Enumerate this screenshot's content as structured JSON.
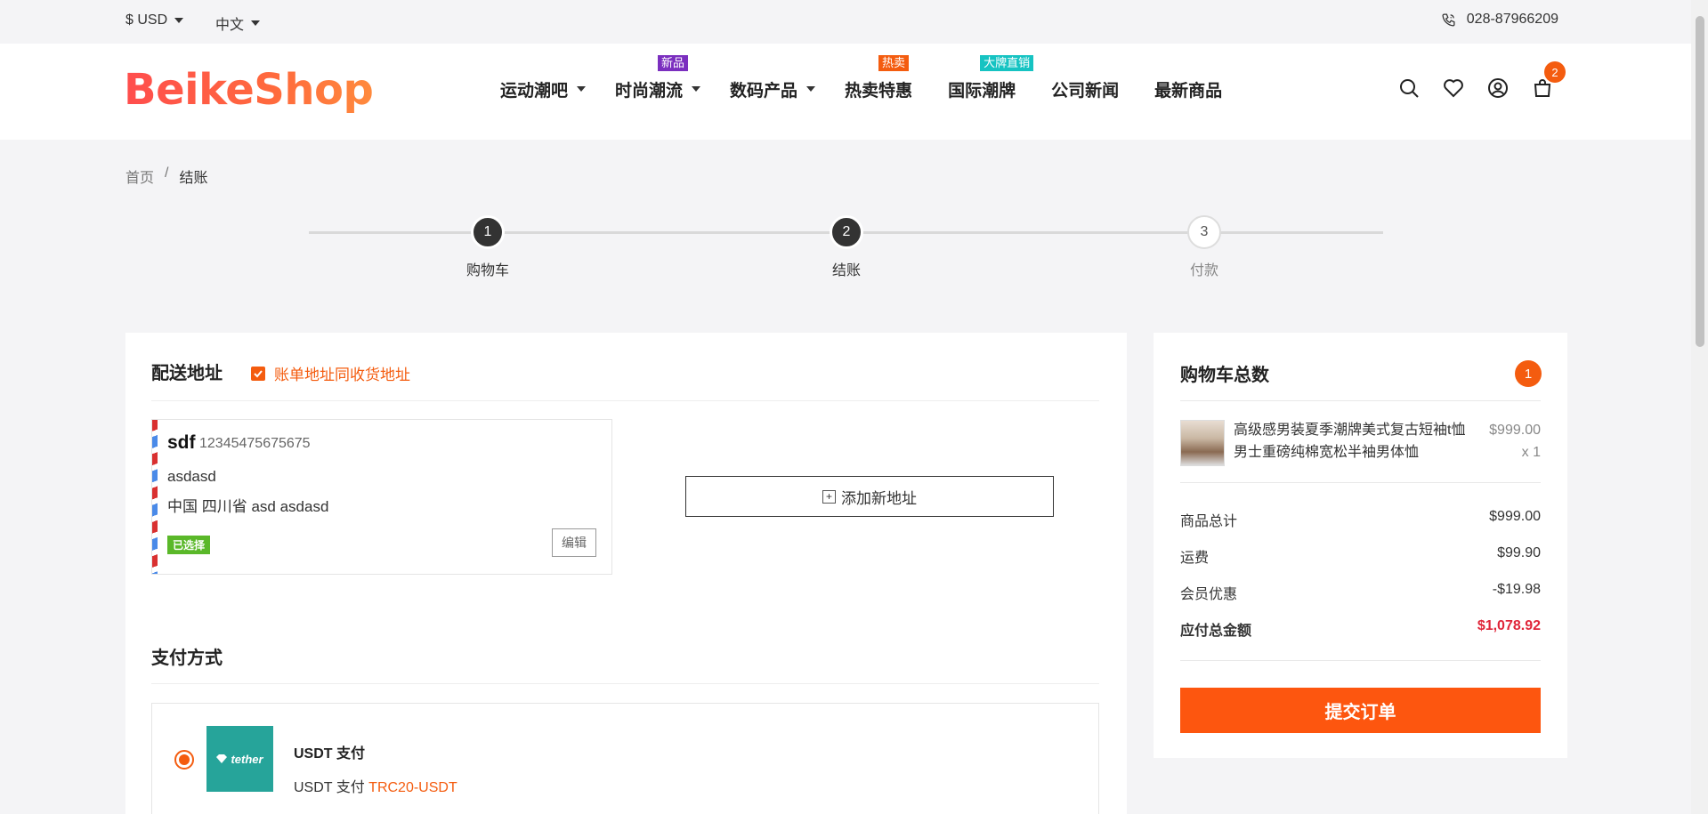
{
  "topbar": {
    "currency": "$ USD",
    "language": "中文",
    "phone": "028-87966209"
  },
  "header": {
    "logo": "BeikeShop",
    "nav": [
      {
        "label": "运动潮吧",
        "has_dropdown": true,
        "badge": null
      },
      {
        "label": "时尚潮流",
        "has_dropdown": true,
        "badge": "新品",
        "badge_color": "#7b2fbf"
      },
      {
        "label": "数码产品",
        "has_dropdown": true,
        "badge": null
      },
      {
        "label": "热卖特惠",
        "has_dropdown": false,
        "badge": "热卖",
        "badge_color": "#f45c0f"
      },
      {
        "label": "国际潮牌",
        "has_dropdown": false,
        "badge": "大牌直销",
        "badge_color": "#16c3c2"
      },
      {
        "label": "公司新闻",
        "has_dropdown": false,
        "badge": null
      },
      {
        "label": "最新商品",
        "has_dropdown": false,
        "badge": null
      }
    ],
    "cart_count": "2",
    "icons": [
      "search-icon",
      "heart-icon",
      "user-icon",
      "cart-icon"
    ]
  },
  "breadcrumb": {
    "home": "首页",
    "separator": "/",
    "current": "结账"
  },
  "steps": [
    {
      "number": "1",
      "label": "购物车",
      "state": "done"
    },
    {
      "number": "2",
      "label": "结账",
      "state": "done"
    },
    {
      "number": "3",
      "label": "付款",
      "state": "todo"
    }
  ],
  "shipping": {
    "title": "配送地址",
    "same_billing_label": "账单地址同收货地址",
    "same_billing_checked": true,
    "address": {
      "name": "sdf",
      "phone": "12345475675675",
      "line1": "asdasd",
      "line2": "中国 四川省 asd asdasd",
      "selected_tag": "已选择",
      "edit_label": "编辑"
    },
    "add_address_label": "添加新地址"
  },
  "payment": {
    "title": "支付方式",
    "method": {
      "logo_text": "tether",
      "name": "USDT 支付",
      "desc_prefix": "USDT 支付",
      "desc_highlight": "TRC20-USDT",
      "selected": true
    }
  },
  "cart_summary": {
    "title": "购物车总数",
    "count": "1",
    "product": {
      "name": "高级感男装夏季潮牌美式复古短袖t恤男士重磅纯棉宽松半袖男体恤",
      "price": "$999.00",
      "qty": "x 1"
    },
    "rows": [
      {
        "label": "商品总计",
        "value": "$999.00"
      },
      {
        "label": "运费",
        "value": "$99.90"
      },
      {
        "label": "会员优惠",
        "value": "-$19.98"
      }
    ],
    "total": {
      "label": "应付总金额",
      "value": "$1,078.92"
    },
    "submit_label": "提交订单"
  },
  "colors": {
    "accent": "#f45c0f",
    "total_red": "#e0263a",
    "tag_green": "#5ab829",
    "tether_green": "#26a49a"
  }
}
